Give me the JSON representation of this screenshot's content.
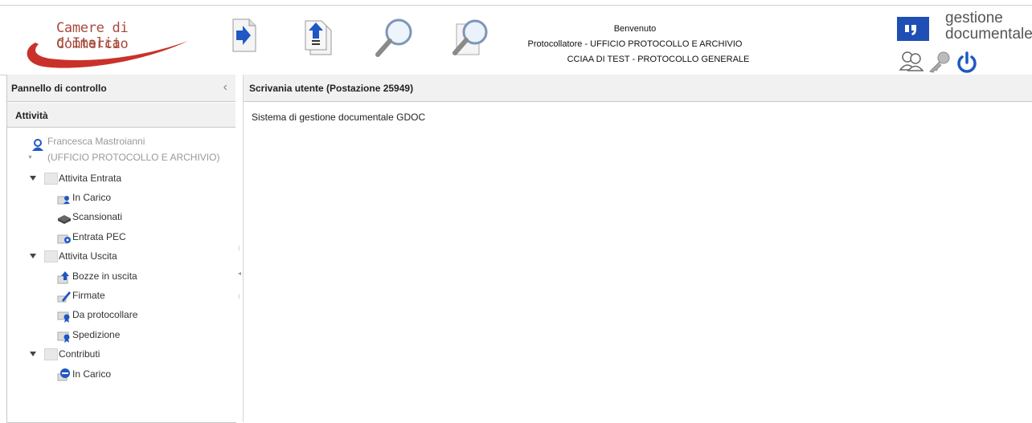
{
  "header": {
    "logo_line1": "Camere di Commercio",
    "logo_line2": "d'Italia",
    "toolbar_icons": [
      "forward-arrow-document-icon",
      "upload-document-icon",
      "search-magnifier-icon",
      "search-document-icon"
    ],
    "welcome": "Benvenuto",
    "role": "Protocollatore - UFFICIO PROTOCOLLO E ARCHIVIO",
    "entity": "CCIAA DI TEST - PROTOCOLLO GENERALE",
    "brand_line1": "gestione",
    "brand_line2": "documentale",
    "brand_color": "#1f4fb5",
    "user_icons": [
      "users-icon",
      "key-icon",
      "power-icon"
    ]
  },
  "sidebar": {
    "panel_title": "Pannello di controllo",
    "collapse_glyph": "‹",
    "accordion_title": "Attività",
    "user_name": "Francesca Mastroianni",
    "user_office": "(UFFICIO PROTOCOLLO E ARCHIVIO)",
    "groups": [
      {
        "label": "Attivita Entrata",
        "items": [
          {
            "label": "In Carico",
            "icon": "incoming-user-icon"
          },
          {
            "label": "Scansionati",
            "icon": "scanner-icon"
          },
          {
            "label": "Entrata PEC",
            "icon": "pec-mail-icon"
          }
        ]
      },
      {
        "label": "Attivita Uscita",
        "items": [
          {
            "label": "Bozze in uscita",
            "icon": "draft-outgoing-icon"
          },
          {
            "label": "Firmate",
            "icon": "signed-pen-icon"
          },
          {
            "label": "Da protocollare",
            "icon": "to-register-icon"
          },
          {
            "label": "Spedizione",
            "icon": "shipping-icon"
          }
        ]
      },
      {
        "label": "Contributi",
        "items": [
          {
            "label": "In Carico",
            "icon": "contribution-chat-icon"
          }
        ]
      }
    ]
  },
  "main": {
    "title": "Scrivania utente (Postazione 25949)",
    "content": "Sistema di gestione documentale GDOC"
  },
  "colors": {
    "accent_red": "#a84a3c",
    "icon_blue": "#2a6fd1",
    "panel_header_bg": "#f1f1f1"
  }
}
